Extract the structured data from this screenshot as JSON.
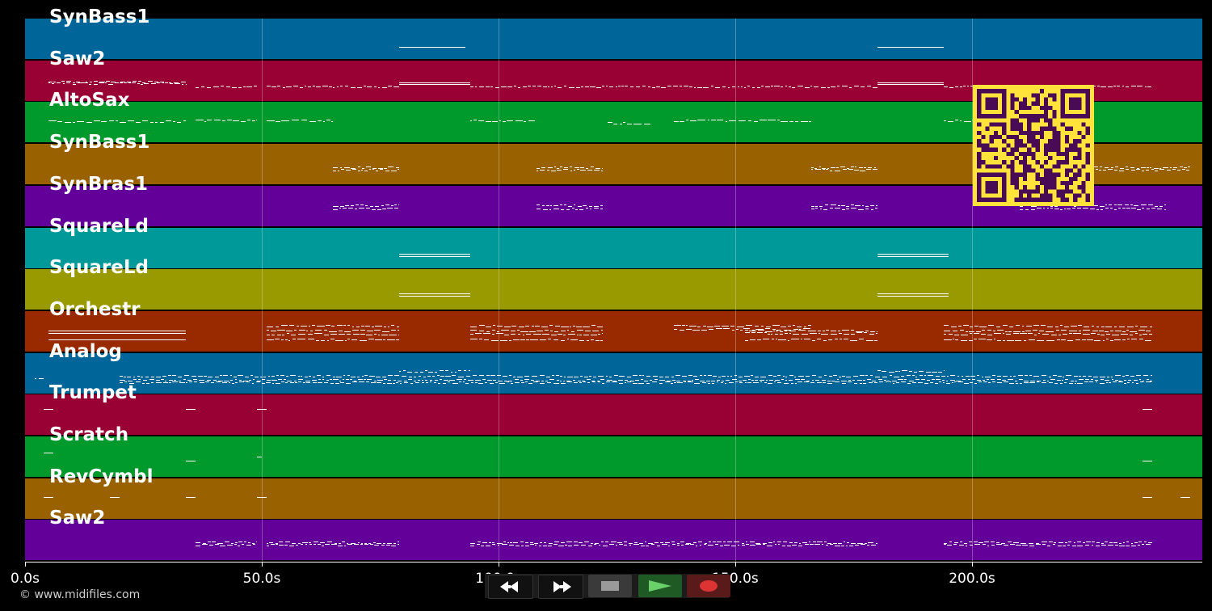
{
  "tracks": [
    {
      "label": "SynBass1",
      "color": "#00669a"
    },
    {
      "label": "Saw2",
      "color": "#990033"
    },
    {
      "label": "AltoSax",
      "color": "#00992c"
    },
    {
      "label": "SynBass1",
      "color": "#996100"
    },
    {
      "label": "SynBras1",
      "color": "#620099"
    },
    {
      "label": "SquareLd",
      "color": "#009999"
    },
    {
      "label": "SquareLd",
      "color": "#999900"
    },
    {
      "label": "Orchestr",
      "color": "#992a00"
    },
    {
      "label": "Analog",
      "color": "#00669a"
    },
    {
      "label": "Trumpet",
      "color": "#990033"
    },
    {
      "label": "Scratch",
      "color": "#00992c"
    },
    {
      "label": "RevCymbl",
      "color": "#996100"
    },
    {
      "label": "Saw2",
      "color": "#620099"
    }
  ],
  "timeline": {
    "ticks": [
      "0.0s",
      "50.0s",
      "100.0s",
      "150.0s",
      "200.0s"
    ],
    "tick_values": [
      0,
      50,
      100,
      150,
      200
    ],
    "end_seconds": 248.6
  },
  "credit": "© www.midifiles.com",
  "transport": {
    "rewind_icon": "rewind-icon",
    "fastforward_icon": "fast-forward-icon",
    "stop_icon": "stop-icon",
    "play_icon": "play-icon",
    "record_icon": "record-icon"
  },
  "colors": {
    "background": "#000000",
    "qr_fg": "#4a0b56",
    "qr_bg": "#ffe23a"
  }
}
